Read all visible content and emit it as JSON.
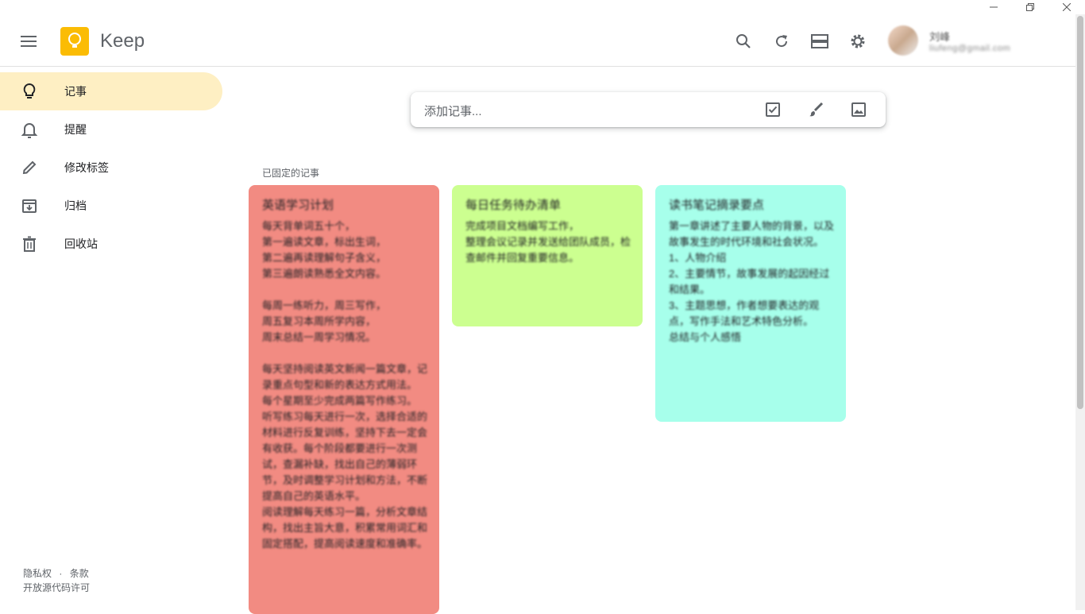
{
  "app": {
    "title": "Keep"
  },
  "user": {
    "name": "刘峰",
    "email": "liufeng@gmail.com"
  },
  "composer": {
    "placeholder": "添加记事..."
  },
  "sidebar": {
    "items": [
      {
        "label": "记事",
        "icon": "lightbulb-icon",
        "active": true
      },
      {
        "label": "提醒",
        "icon": "bell-icon",
        "active": false
      },
      {
        "label": "修改标签",
        "icon": "pencil-icon",
        "active": false
      },
      {
        "label": "归档",
        "icon": "archive-icon",
        "active": false
      },
      {
        "label": "回收站",
        "icon": "trash-icon",
        "active": false
      }
    ],
    "footer": {
      "privacy": "隐私权",
      "separator": "·",
      "terms": "条款",
      "license": "开放源代码许可"
    }
  },
  "pinned": {
    "title": "已固定的记事",
    "notes": [
      {
        "title": "英语学习计划",
        "body": "每天背单词五十个，\n第一遍读文章，标出生词，\n第二遍再读理解句子含义，\n第三遍朗读熟悉全文内容。\n\n每周一练听力，周三写作，\n周五复习本周所学内容，\n周末总结一周学习情况。\n\n每天坚持阅读英文新闻一篇文章，记录重点句型和新的表达方式用法。\n每个星期至少完成两篇写作练习。\n听写练习每天进行一次，选择合适的材料进行反复训练，坚持下去一定会有收获。每个阶段都要进行一次测试，查漏补缺，找出自己的薄弱环节，及时调整学习计划和方法，不断提高自己的英语水平。\n阅读理解每天练习一篇，分析文章结构，找出主旨大意，积累常用词汇和固定搭配，提高阅读速度和准确率。",
        "color": "#f28b82"
      },
      {
        "title": "每日任务待办清单",
        "body": "完成项目文档编写工作，\n整理会议记录并发送给团队成员，检查邮件并回复重要信息。",
        "color": "#ccff90"
      },
      {
        "title": "读书笔记摘录要点",
        "body": "第一章讲述了主要人物的背景，以及故事发生的时代环境和社会状况。\n1、人物介绍\n2、主要情节，故事发展的起因经过和结果。\n3、主题思想，作者想要表达的观点，写作手法和艺术特色分析。\n总结与个人感悟",
        "color": "#a7ffeb"
      }
    ]
  },
  "colors": {
    "active_nav_bg": "#feefc3",
    "logo": "#fbbc04"
  }
}
